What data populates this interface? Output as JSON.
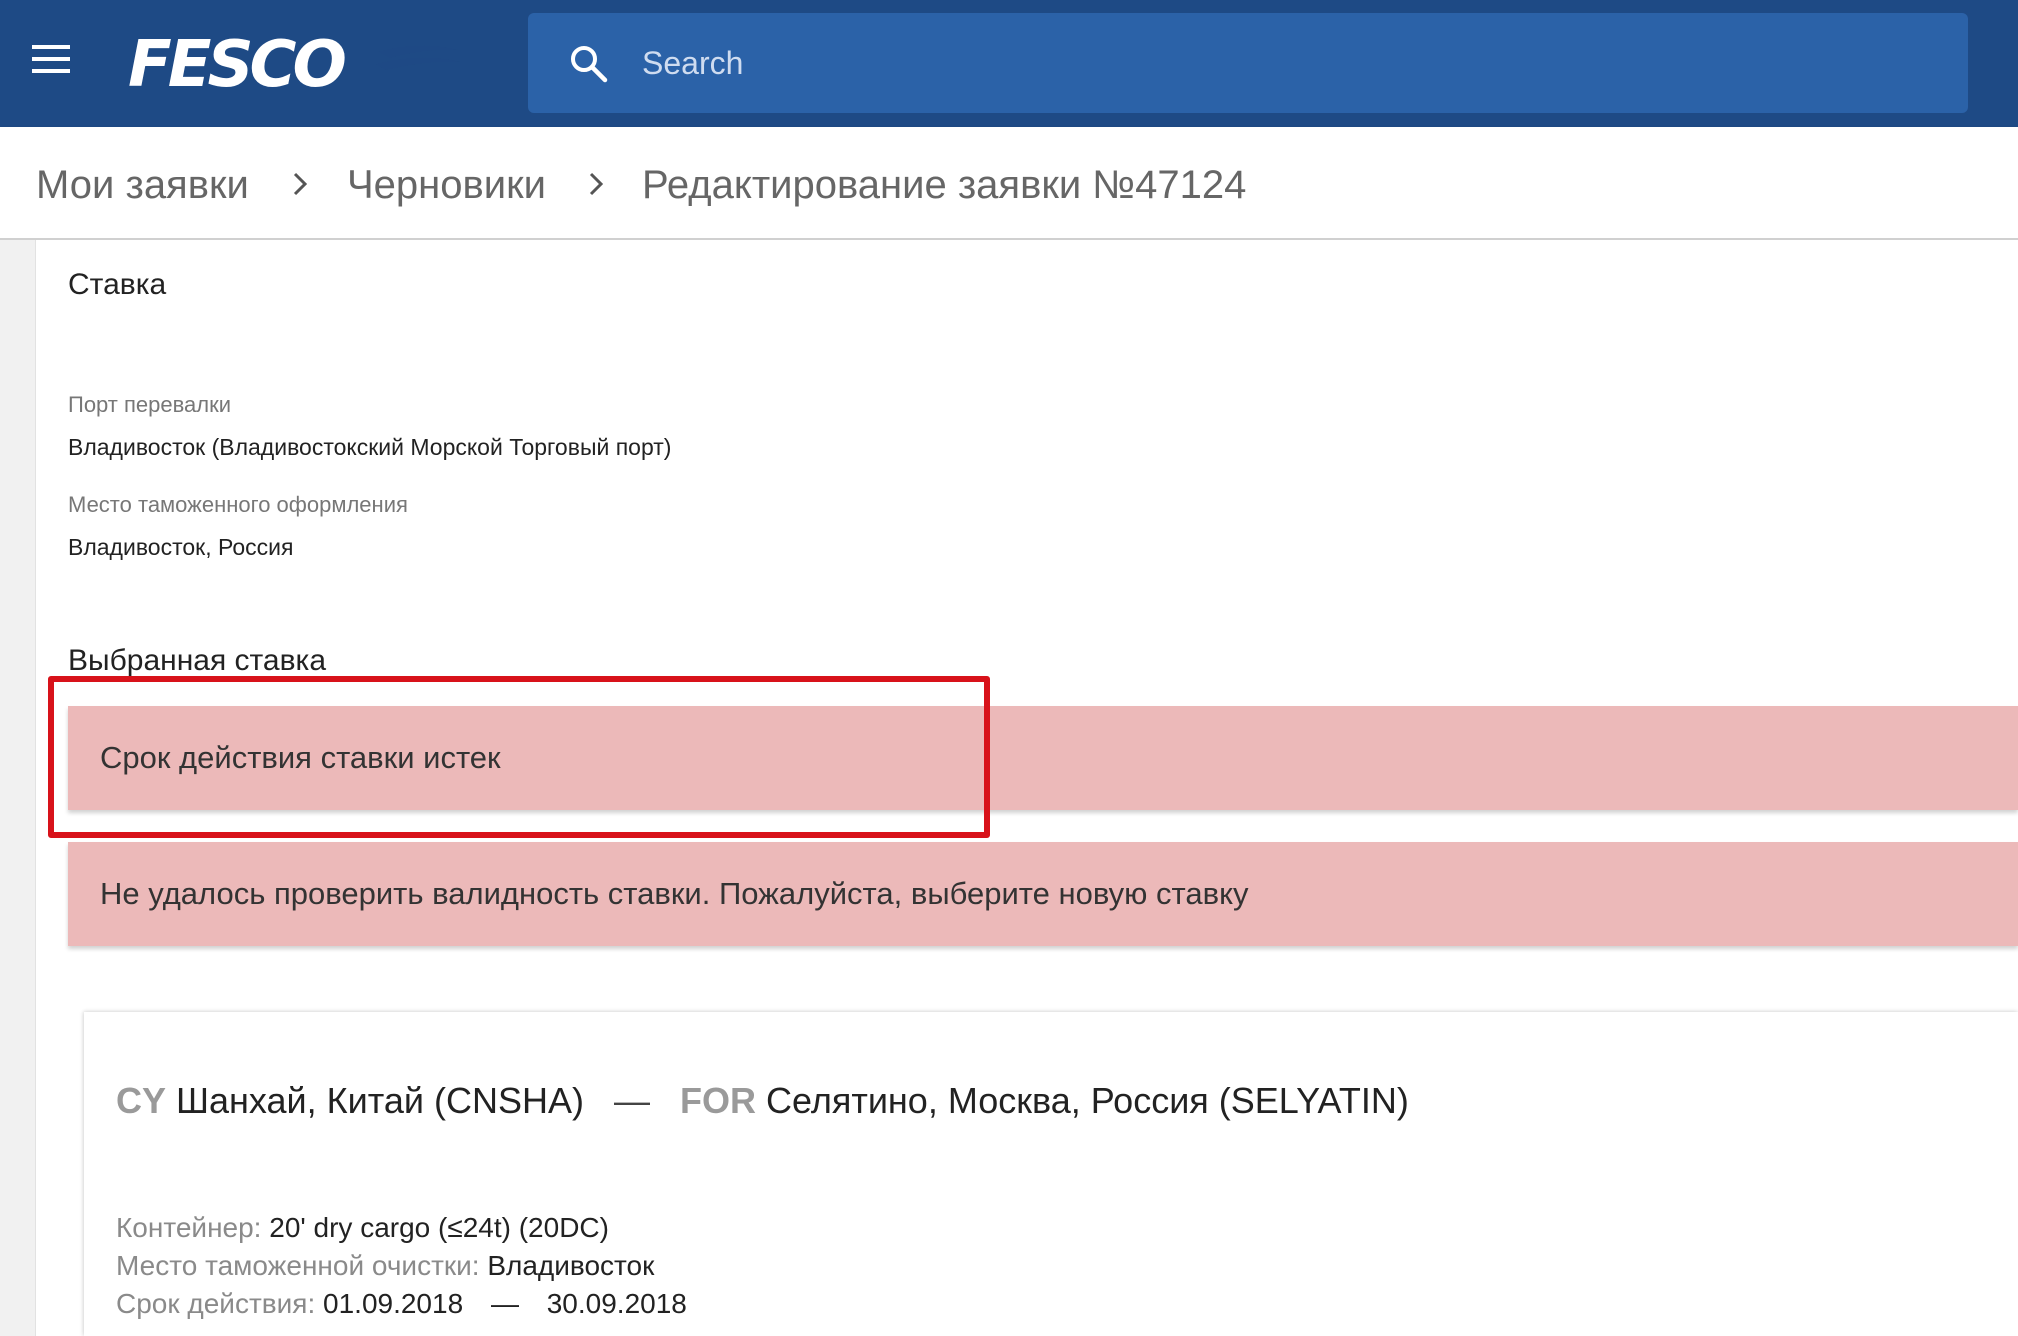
{
  "header": {
    "logo_text": "FESCO",
    "search_placeholder": "Search",
    "colors": {
      "bar": "#1e4a85",
      "search": "#2b62a8"
    }
  },
  "breadcrumb": {
    "items": [
      "Мои заявки",
      "Черновики",
      "Редактирование заявки №47124"
    ]
  },
  "rate": {
    "section_title": "Ставка",
    "fields": [
      {
        "label": "Порт перевалки",
        "value": "Владивосток (Владивостокский Морской Торговый порт)"
      },
      {
        "label": "Место таможенного оформления",
        "value": "Владивосток, Россия"
      }
    ],
    "selected_title": "Выбранная ставка",
    "alerts": [
      "Срок действия ставки истек",
      "Не удалось проверить валидность ставки. Пожалуйста, выберите новую ставку"
    ],
    "alert_color": "#ecb9b9",
    "highlight_color": "#d8121a"
  },
  "card": {
    "origin_tag": "CY",
    "origin": "Шанхай, Китай (CNSHA)",
    "route_dash": "—",
    "dest_tag": "FOR",
    "destination": "Селятино, Москва, Россия (SELYATIN)",
    "container_label": "Контейнер:",
    "container_value": "20' dry cargo (≤24t) (20DC)",
    "customs_label": "Место таможенной очистки:",
    "customs_value": "Владивосток",
    "validity_label": "Срок действия:",
    "validity_from": "01.09.2018",
    "validity_sep": "—",
    "validity_to": "30.09.2018"
  }
}
